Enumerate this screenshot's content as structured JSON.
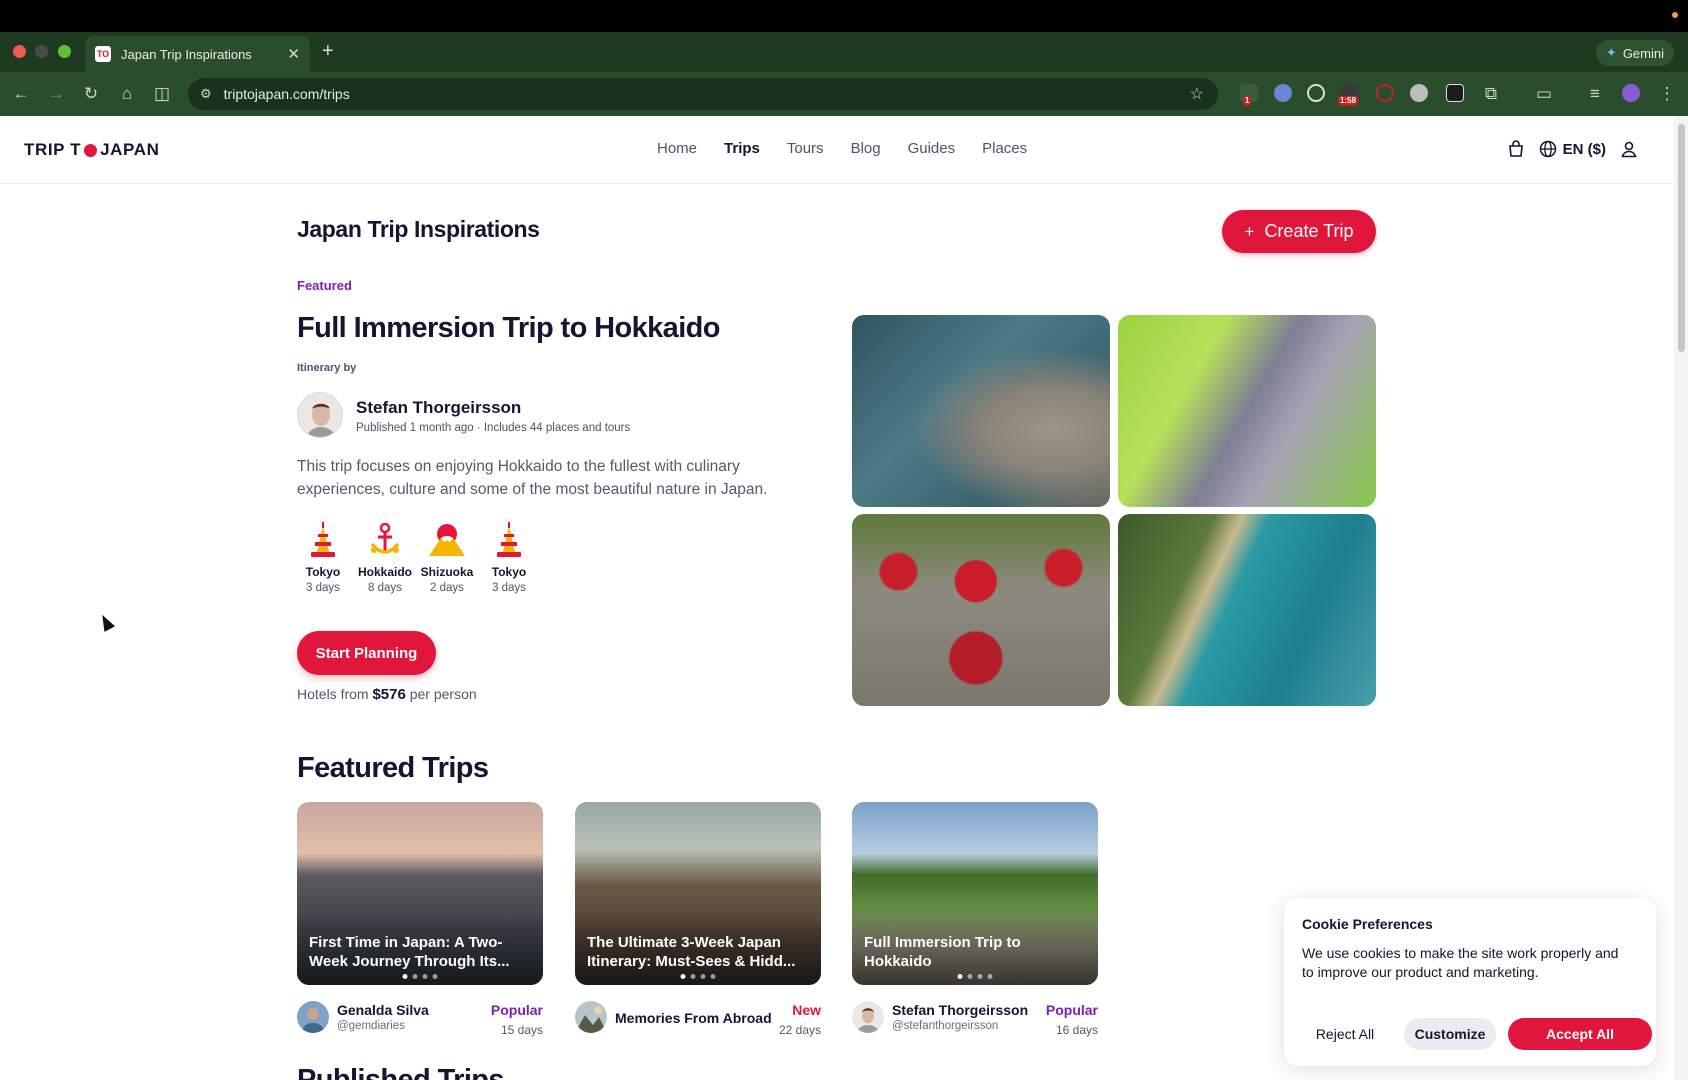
{
  "browser": {
    "tab_title": "Japan Trip Inspirations",
    "tab_favicon": "TO",
    "url": "triptojapan.com/trips",
    "gemini_label": "Gemini",
    "ext_badge_1": "1",
    "ext_badge_timer": "1:58"
  },
  "site": {
    "logo_left": "TRIP T",
    "logo_right": "JAPAN",
    "nav": [
      "Home",
      "Trips",
      "Tours",
      "Blog",
      "Guides",
      "Places"
    ],
    "active_nav": "Trips",
    "lang": "EN ($)"
  },
  "inspirations": {
    "heading": "Japan Trip Inspirations",
    "create_label": "Create Trip"
  },
  "featured_trip": {
    "tag": "Featured",
    "title": "Full Immersion Trip to Hokkaido",
    "itinerary_by": "Itinerary by",
    "author": "Stefan Thorgeirsson",
    "meta": "Published 1 month ago · Includes 44 places and tours",
    "description": "This trip focuses on enjoying Hokkaido to the fullest with culinary experiences, culture and some of the most beautiful nature in Japan.",
    "stops": [
      {
        "city": "Tokyo",
        "days": "3 days",
        "icon": "tokyo-tower-icon"
      },
      {
        "city": "Hokkaido",
        "days": "8 days",
        "icon": "hokkaido-anchor-icon"
      },
      {
        "city": "Shizuoka",
        "days": "2 days",
        "icon": "mount-fuji-icon"
      },
      {
        "city": "Tokyo",
        "days": "3 days",
        "icon": "tokyo-tower-icon"
      }
    ],
    "plan_label": "Start Planning",
    "hotels_prefix": "Hotels from",
    "hotels_price": "$576",
    "hotels_suffix": "per person"
  },
  "featured_trips": {
    "heading": "Featured Trips",
    "cards": [
      {
        "caption": "First Time in Japan: A Two-Week Journey Through Its...",
        "author": "Genalda Silva",
        "handle": "@gemdiaries",
        "badge": "Popular",
        "badge_color": "#7a20b8",
        "duration": "15 days"
      },
      {
        "caption": "The Ultimate 3-Week Japan Itinerary: Must-Sees & Hidd...",
        "author": "Memories From Abroad",
        "handle": "",
        "badge": "New",
        "badge_color": "#e0163d",
        "duration": "22 days"
      },
      {
        "caption": "Full Immersion Trip to Hokkaido",
        "author": "Stefan Thorgeirsson",
        "handle": "@stefanthorgeirsson",
        "badge": "Popular",
        "badge_color": "#7a20b8",
        "duration": "16 days"
      }
    ]
  },
  "published": {
    "heading": "Published Trips"
  },
  "cookie": {
    "title": "Cookie Preferences",
    "body": "We use cookies to make the site work properly and to improve our product and marketing.",
    "reject": "Reject All",
    "customize": "Customize",
    "accept": "Accept All"
  },
  "colors": {
    "brand_red": "#e0163d",
    "featured_purple": "#7a20b8",
    "browser_green": "#2a4d2e"
  }
}
